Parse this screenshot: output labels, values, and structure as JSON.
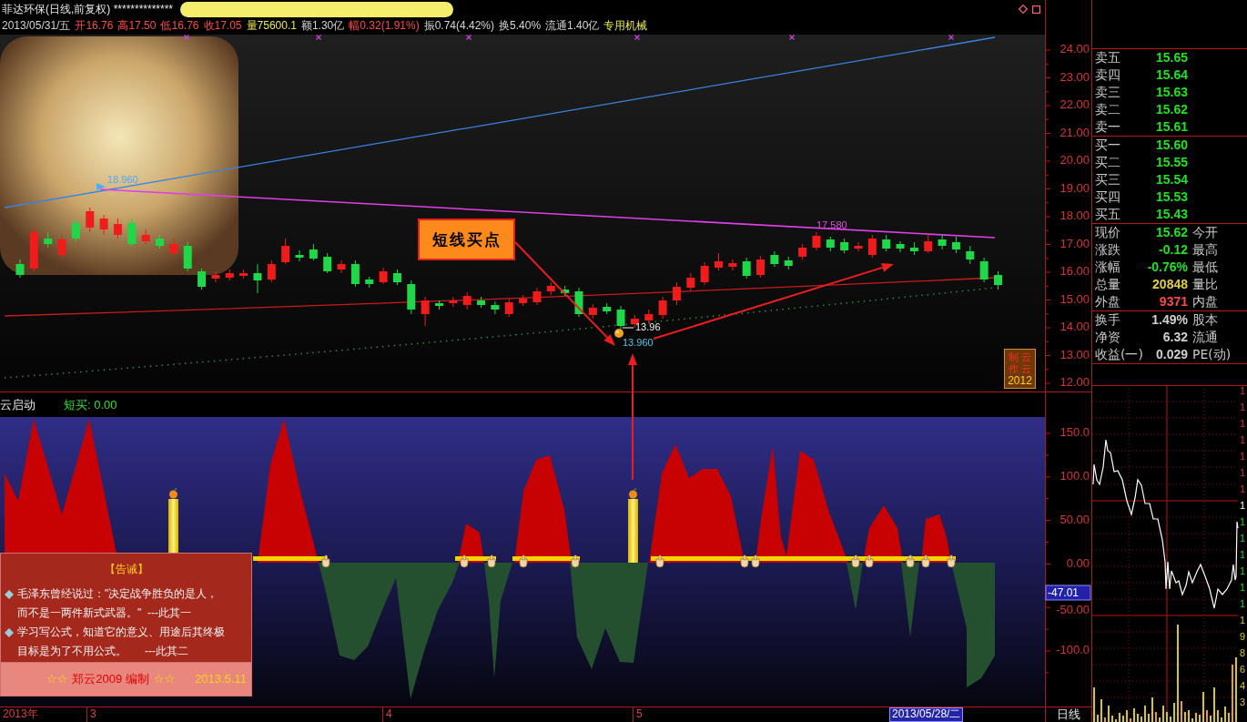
{
  "header": {
    "title": "菲达环保(日线,前复权) **************",
    "quote_line": [
      {
        "text": "2013/05/31/五",
        "kind": "plain"
      },
      {
        "text": "开16.76",
        "kind": "price"
      },
      {
        "text": "高17.50",
        "kind": "price"
      },
      {
        "text": "低16.76",
        "kind": "price"
      },
      {
        "text": "收17.05",
        "kind": "price"
      },
      {
        "text": "量75600.1",
        "kind": "volume"
      },
      {
        "text": "额1.30亿",
        "kind": "plain"
      },
      {
        "text": "幅0.32(1.91%)",
        "kind": "price"
      },
      {
        "text": "振0.74(4.42%)",
        "kind": "plain"
      },
      {
        "text": "换5.40%",
        "kind": "plain"
      },
      {
        "text": "流通1.40亿",
        "kind": "plain"
      },
      {
        "text": "专用机械",
        "kind": "industry"
      }
    ]
  },
  "main_chart": {
    "price_axis": [
      "24.00",
      "23.00",
      "22.00",
      "21.00",
      "20.00",
      "19.00",
      "18.00",
      "17.00",
      "16.00",
      "15.00",
      "14.00",
      "13.00",
      "12.00"
    ],
    "labels": [
      {
        "text": "18.960",
        "kind": "peak"
      },
      {
        "text": "17.580",
        "kind": "line-value"
      },
      {
        "text": "13.96",
        "kind": "low"
      },
      {
        "text": "13.960",
        "kind": "low-line"
      }
    ],
    "annotation": "短线买点",
    "signature": {
      "lines": [
        "制 云",
        "作 云"
      ],
      "year": "2012"
    }
  },
  "indicator": {
    "name": "云启动",
    "reading": "短买: 0.00",
    "axis": [
      "150.0",
      "100.0",
      "50.00",
      "0.00",
      "-50.00",
      "-100.0"
    ],
    "current_value": "-47.01"
  },
  "note": {
    "title": "【告诫】",
    "items": [
      {
        "lines": [
          "毛泽东曾经说过：\"决定战争胜负的是人，",
          "而不是一两件新式武器。\"  ---此其一"
        ]
      },
      {
        "lines": [
          "学习写公式，知道它的意义、用途后其终极",
          "目标是为了不用公式。      ---此其二"
        ]
      }
    ],
    "footer": {
      "stars_left": "☆☆",
      "author": "郑云2009 编制",
      "stars_right": "☆☆",
      "date": "2013.5.11"
    }
  },
  "time_axis": {
    "labels": [
      "2013年",
      "3",
      "4",
      "5"
    ],
    "cursor_date": "2013/05/28/二",
    "period": "日线"
  },
  "quote_panel": {
    "sections": [
      {
        "rows": [
          {
            "label": "卖五",
            "value": "15.65",
            "kind": "fall"
          },
          {
            "label": "卖四",
            "value": "15.64",
            "kind": "fall"
          },
          {
            "label": "卖三",
            "value": "15.63",
            "kind": "fall"
          },
          {
            "label": "卖二",
            "value": "15.62",
            "kind": "fall"
          },
          {
            "label": "卖一",
            "value": "15.61",
            "kind": "fall"
          }
        ]
      },
      {
        "rows": [
          {
            "label": "买一",
            "value": "15.60",
            "kind": "fall"
          },
          {
            "label": "买二",
            "value": "15.55",
            "kind": "fall"
          },
          {
            "label": "买三",
            "value": "15.54",
            "kind": "fall"
          },
          {
            "label": "买四",
            "value": "15.53",
            "kind": "fall"
          },
          {
            "label": "买五",
            "value": "15.43",
            "kind": "fall"
          }
        ]
      },
      {
        "rows": [
          {
            "label": "现价",
            "value": "15.62",
            "kind": "fall",
            "side_label": "今开"
          },
          {
            "label": "涨跌",
            "value": "-0.12",
            "kind": "fall",
            "side_label": "最高"
          },
          {
            "label": "涨幅",
            "value": "-0.76%",
            "kind": "fall",
            "side_label": "最低"
          },
          {
            "label": "总量",
            "value": "20848",
            "kind": "volume",
            "side_label": "量比"
          },
          {
            "label": "外盘",
            "value": "9371",
            "kind": "rise",
            "side_label": "内盘"
          }
        ]
      },
      {
        "rows": [
          {
            "label": "换手",
            "value": "1.49%",
            "kind": "plain",
            "side_label": "股本"
          },
          {
            "label": "净资",
            "value": "6.32",
            "kind": "plain",
            "side_label": "流通"
          },
          {
            "label": "收益(一)",
            "value": "0.029",
            "kind": "plain",
            "side_label": "PE(动)"
          }
        ]
      }
    ]
  },
  "intraday": {
    "axis": [
      {
        "text": "1",
        "kind": "rise"
      },
      {
        "text": "1",
        "kind": "rise"
      },
      {
        "text": "1",
        "kind": "rise"
      },
      {
        "text": "1",
        "kind": "rise"
      },
      {
        "text": "1",
        "kind": "rise"
      },
      {
        "text": "1",
        "kind": "rise"
      },
      {
        "text": "1",
        "kind": "rise"
      },
      {
        "text": "1",
        "kind": "flat"
      },
      {
        "text": "1",
        "kind": "fall"
      },
      {
        "text": "1",
        "kind": "fall"
      },
      {
        "text": "1",
        "kind": "fall"
      },
      {
        "text": "1",
        "kind": "fall"
      },
      {
        "text": "1",
        "kind": "fall"
      },
      {
        "text": "1",
        "kind": "fall"
      },
      {
        "text": "1",
        "kind": "volume"
      },
      {
        "text": "9",
        "kind": "volume"
      },
      {
        "text": "8",
        "kind": "volume"
      },
      {
        "text": "6",
        "kind": "volume"
      },
      {
        "text": "4",
        "kind": "volume"
      },
      {
        "text": "3",
        "kind": "volume"
      }
    ]
  }
}
